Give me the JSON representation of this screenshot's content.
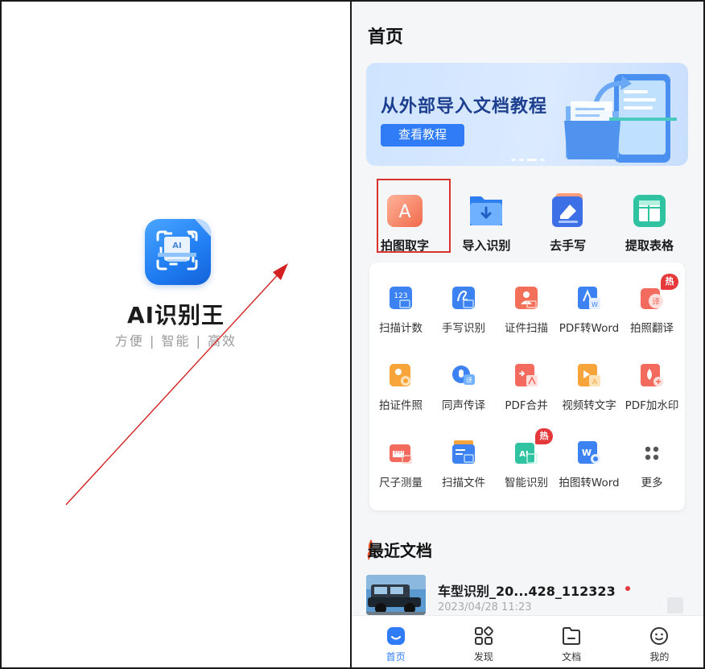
{
  "splash": {
    "app_name": "AI识别王",
    "slogan": "方便 | 智能 | 高效",
    "logo_text": "AI"
  },
  "home": {
    "title": "首页",
    "banner": {
      "title": "从外部导入文档教程",
      "button": "查看教程",
      "dots_count": 4,
      "active_dot": 2
    },
    "quick_actions": [
      {
        "label": "拍图取字",
        "icon": "photo-text-icon",
        "letter": "A"
      },
      {
        "label": "导入识别",
        "icon": "import-folder-icon"
      },
      {
        "label": "去手写",
        "icon": "eraser-icon"
      },
      {
        "label": "提取表格",
        "icon": "table-icon"
      }
    ],
    "tools": [
      {
        "label": "扫描计数",
        "icon": "scan-count-icon",
        "text": "123"
      },
      {
        "label": "手写识别",
        "icon": "handwriting-icon"
      },
      {
        "label": "证件扫描",
        "icon": "id-scan-icon"
      },
      {
        "label": "PDF转Word",
        "icon": "pdf-to-word-icon"
      },
      {
        "label": "拍照翻译",
        "icon": "photo-translate-icon",
        "badge": "热",
        "inner": "译"
      },
      {
        "label": "拍证件照",
        "icon": "id-photo-icon"
      },
      {
        "label": "同声传译",
        "icon": "interpret-icon",
        "inner": "译"
      },
      {
        "label": "PDF合并",
        "icon": "pdf-merge-icon"
      },
      {
        "label": "视频转文字",
        "icon": "video-to-text-icon",
        "inner": "A"
      },
      {
        "label": "PDF加水印",
        "icon": "pdf-watermark-icon"
      },
      {
        "label": "尺子测量",
        "icon": "ruler-icon"
      },
      {
        "label": "扫描文件",
        "icon": "scan-file-icon"
      },
      {
        "label": "智能识别",
        "icon": "smart-recognize-icon",
        "badge": "热",
        "inner": "AI"
      },
      {
        "label": "拍图转Word",
        "icon": "photo-to-word-icon",
        "inner": "W"
      },
      {
        "label": "更多",
        "icon": "more-icon"
      }
    ],
    "recent": {
      "title": "最近文档",
      "items": [
        {
          "name": "车型识别_20...428_112323",
          "date": "2023/04/28 11:23"
        }
      ]
    },
    "tabbar": [
      {
        "label": "首页",
        "icon": "home-icon",
        "active": true
      },
      {
        "label": "发现",
        "icon": "discover-icon"
      },
      {
        "label": "文档",
        "icon": "document-icon"
      },
      {
        "label": "我的",
        "icon": "profile-icon"
      }
    ]
  },
  "colors": {
    "accent": "#2f7cf6",
    "highlight": "#d93030",
    "badge": "#e5383b"
  }
}
